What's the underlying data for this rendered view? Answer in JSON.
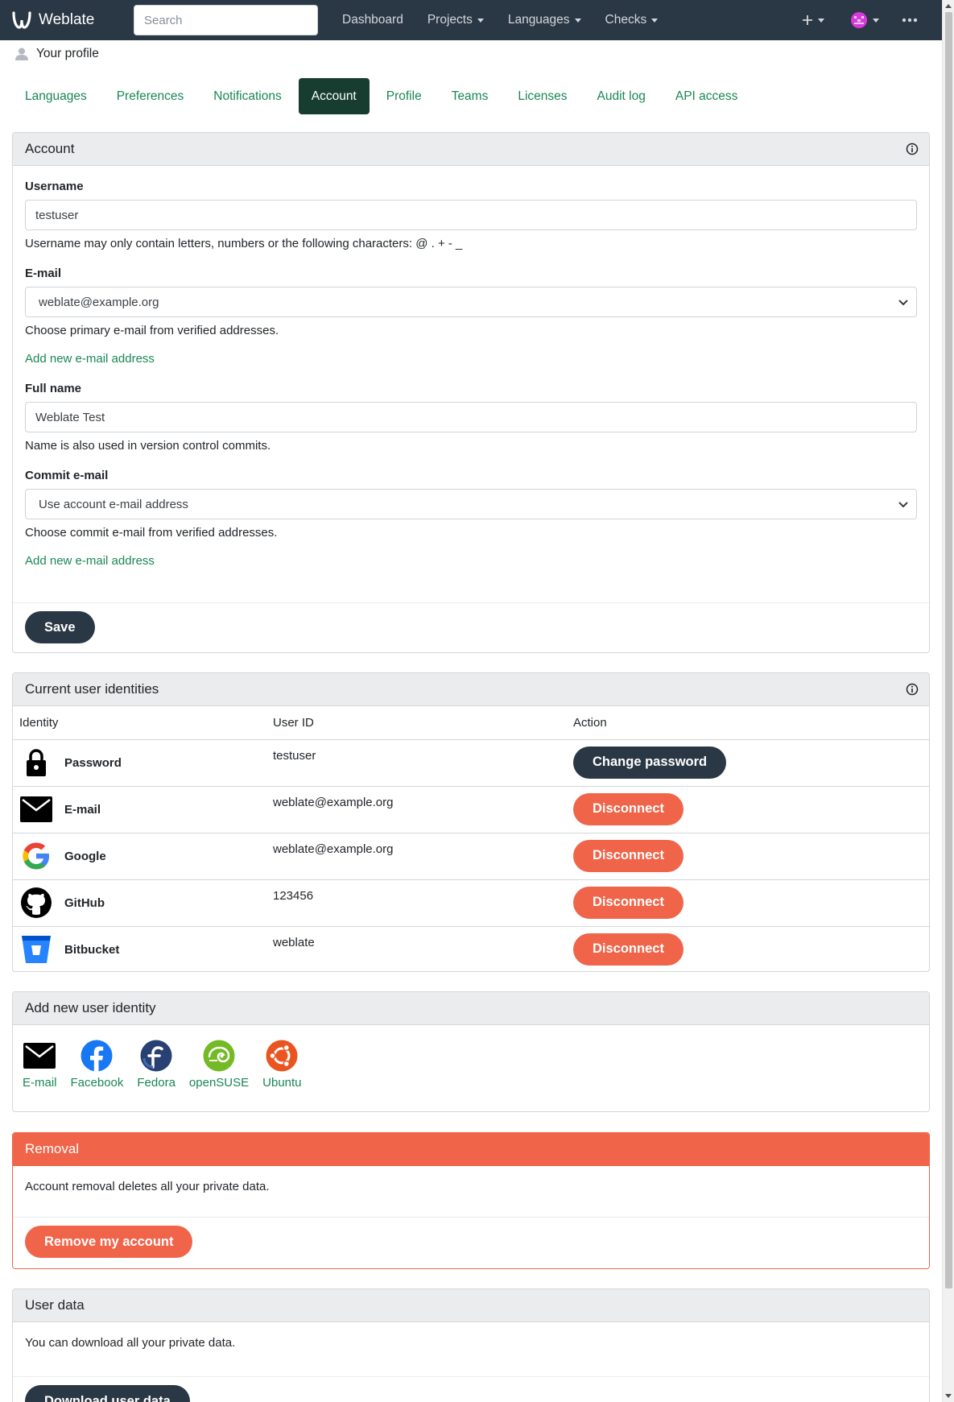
{
  "navbar": {
    "brand": "Weblate",
    "search_placeholder": "Search",
    "links": [
      "Dashboard",
      "Projects",
      "Languages",
      "Checks"
    ]
  },
  "breadcrumb": {
    "label": "Your profile"
  },
  "tabs": [
    "Languages",
    "Preferences",
    "Notifications",
    "Account",
    "Profile",
    "Teams",
    "Licenses",
    "Audit log",
    "API access"
  ],
  "active_tab": "Account",
  "account": {
    "title": "Account",
    "username_label": "Username",
    "username_value": "testuser",
    "username_help": "Username may only contain letters, numbers or the following characters: @ . + - _",
    "email_label": "E-mail",
    "email_value": "weblate@example.org",
    "email_help": "Choose primary e-mail from verified addresses.",
    "add_email_link": "Add new e-mail address",
    "fullname_label": "Full name",
    "fullname_value": "Weblate Test",
    "fullname_help": "Name is also used in version control commits.",
    "commit_email_label": "Commit e-mail",
    "commit_email_value": "Use account e-mail address",
    "commit_email_help": "Choose commit e-mail from verified addresses.",
    "add_commit_email_link": "Add new e-mail address",
    "save_label": "Save"
  },
  "identities": {
    "title": "Current user identities",
    "columns": [
      "Identity",
      "User ID",
      "Action"
    ],
    "rows": [
      {
        "identity": "Password",
        "icon": "lock-icon",
        "user_id": "testuser",
        "action": "Change password"
      },
      {
        "identity": "E-mail",
        "icon": "envelope-icon",
        "user_id": "weblate@example.org",
        "action": "Disconnect"
      },
      {
        "identity": "Google",
        "icon": "google-icon",
        "user_id": "weblate@example.org",
        "action": "Disconnect"
      },
      {
        "identity": "GitHub",
        "icon": "github-icon",
        "user_id": "123456",
        "action": "Disconnect"
      },
      {
        "identity": "Bitbucket",
        "icon": "bitbucket-icon",
        "user_id": "weblate",
        "action": "Disconnect"
      }
    ]
  },
  "add_identity": {
    "title": "Add new user identity",
    "providers": [
      "E-mail",
      "Facebook",
      "Fedora",
      "openSUSE",
      "Ubuntu"
    ]
  },
  "removal": {
    "title": "Removal",
    "text": "Account removal deletes all your private data.",
    "button": "Remove my account"
  },
  "user_data": {
    "title": "User data",
    "text": "You can download all your private data.",
    "button": "Download user data"
  },
  "colors": {
    "navbar": "#2a3744",
    "link": "#198754",
    "active_tab": "#173d30",
    "danger": "#f06449"
  }
}
